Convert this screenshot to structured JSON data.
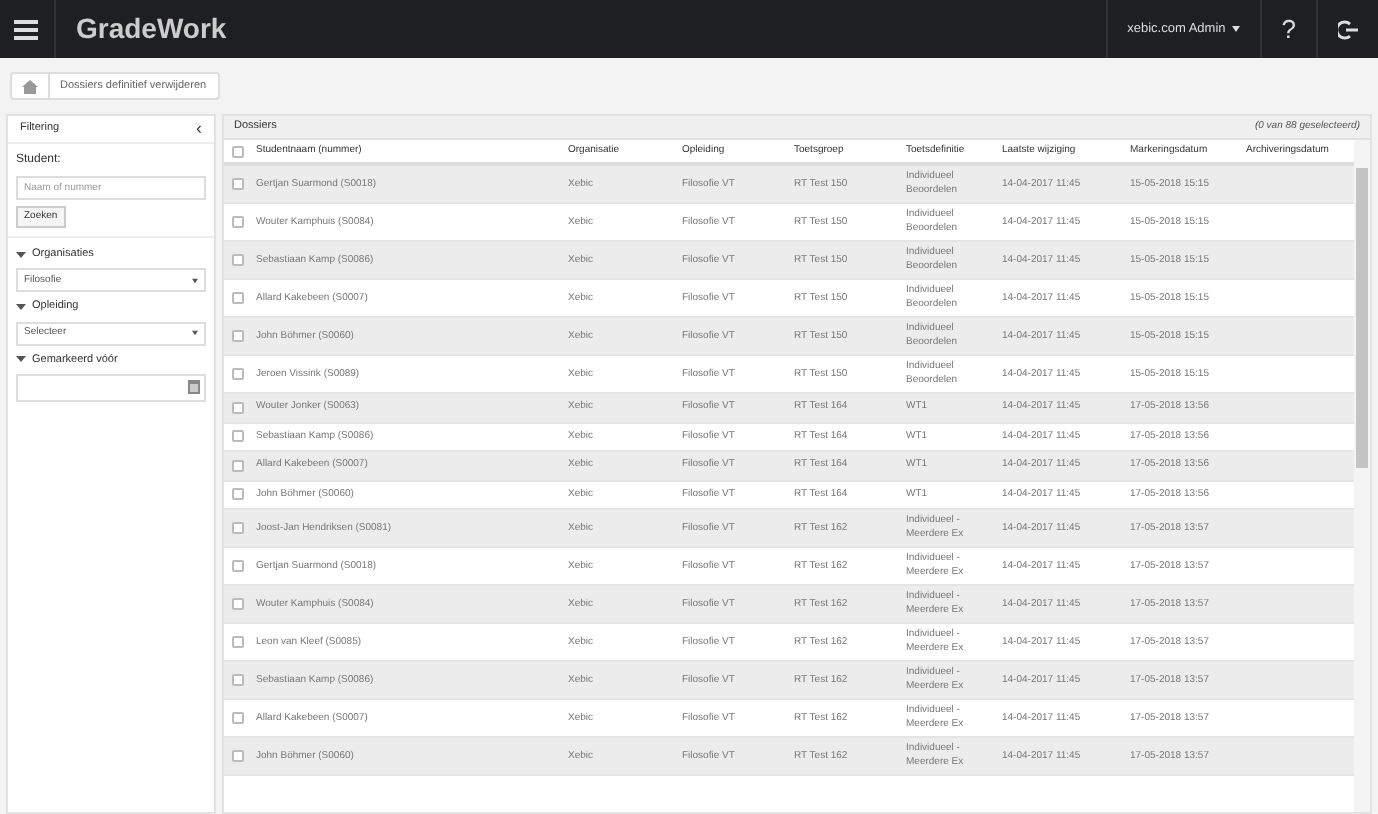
{
  "app": {
    "title": "GradeWork",
    "user_menu": "xebic.com Admin",
    "help": "?"
  },
  "breadcrumb": [
    "Dossiers definitief verwijderen"
  ],
  "filter": {
    "title": "Filtering",
    "collapse": "‹",
    "student_label": "Student:",
    "student_placeholder": "Naam of nummer",
    "search_button": "Zoeken",
    "sections": [
      {
        "label": "Organisaties",
        "expanded": true,
        "kind": "select",
        "value": "Filosofie"
      },
      {
        "label": "Opleiding",
        "expanded": true,
        "kind": "select",
        "value": "Selecteer"
      },
      {
        "label": "Gemarkeerd vóór",
        "expanded": true,
        "kind": "date"
      }
    ]
  },
  "table": {
    "title": "Dossiers",
    "selection_count": "(0 van 88 geselecteerd)",
    "all_checked": false,
    "columns": [
      "Studentnaam (nummer)",
      "Organisatie",
      "Opleiding",
      "Toetsgroep",
      "Toetsdefinitie",
      "Laatste wijziging",
      "Markeringsdatum",
      "Archiveringsdatum"
    ],
    "rows": [
      {
        "checked": false,
        "cells": [
          "Gertjan Suarmond (S0018)",
          "Xebic",
          "Filosofie VT",
          "RT Test 150",
          "Individueel Beoordelen",
          "14-04-2017 11:45",
          "15-05-2018 15:15"
        ]
      },
      {
        "checked": false,
        "cells": [
          "Wouter Kamphuis (S0084)",
          "Xebic",
          "Filosofie VT",
          "RT Test 150",
          "Individueel Beoordelen",
          "14-04-2017 11:45",
          "15-05-2018 15:15"
        ]
      },
      {
        "checked": false,
        "cells": [
          "Sebastiaan Kamp (S0086)",
          "Xebic",
          "Filosofie VT",
          "RT Test 150",
          "Individueel Beoordelen",
          "14-04-2017 11:45",
          "15-05-2018 15:15"
        ]
      },
      {
        "checked": false,
        "cells": [
          "Allard Kakebeen (S0007)",
          "Xebic",
          "Filosofie VT",
          "RT Test 150",
          "Individueel Beoordelen",
          "14-04-2017 11:45",
          "15-05-2018 15:15"
        ]
      },
      {
        "checked": false,
        "cells": [
          "John Böhmer (S0060)",
          "Xebic",
          "Filosofie VT",
          "RT Test 150",
          "Individueel Beoordelen",
          "14-04-2017 11:45",
          "15-05-2018 15:15"
        ]
      },
      {
        "checked": false,
        "cells": [
          "Jeroen Vissink (S0089)",
          "Xebic",
          "Filosofie VT",
          "RT Test 150",
          "Individueel Beoordelen",
          "14-04-2017 11:45",
          "15-05-2018 15:15"
        ]
      },
      {
        "checked": false,
        "cells": [
          "Wouter Jonker (S0063)",
          "Xebic",
          "Filosofie VT",
          "RT Test 164",
          "WT1",
          "14-04-2017 11:45",
          "17-05-2018 13:56"
        ]
      },
      {
        "checked": false,
        "cells": [
          "Sebastiaan Kamp (S0086)",
          "Xebic",
          "Filosofie VT",
          "RT Test 164",
          "WT1",
          "14-04-2017 11:45",
          "17-05-2018 13:56"
        ]
      },
      {
        "checked": false,
        "cells": [
          "Allard Kakebeen (S0007)",
          "Xebic",
          "Filosofie VT",
          "RT Test 164",
          "WT1",
          "14-04-2017 11:45",
          "17-05-2018 13:56"
        ]
      },
      {
        "checked": false,
        "cells": [
          "John Böhmer (S0060)",
          "Xebic",
          "Filosofie VT",
          "RT Test 164",
          "WT1",
          "14-04-2017 11:45",
          "17-05-2018 13:56"
        ]
      },
      {
        "checked": false,
        "cells": [
          "Joost-Jan Hendriksen (S0081)",
          "Xebic",
          "Filosofie VT",
          "RT Test 162",
          "Individueel - Meerdere Ex",
          "14-04-2017 11:45",
          "17-05-2018 13:57"
        ]
      },
      {
        "checked": false,
        "cells": [
          "Gertjan Suarmond (S0018)",
          "Xebic",
          "Filosofie VT",
          "RT Test 162",
          "Individueel - Meerdere Ex",
          "14-04-2017 11:45",
          "17-05-2018 13:57"
        ]
      },
      {
        "checked": false,
        "cells": [
          "Wouter Kamphuis (S0084)",
          "Xebic",
          "Filosofie VT",
          "RT Test 162",
          "Individueel - Meerdere Ex",
          "14-04-2017 11:45",
          "17-05-2018 13:57"
        ]
      },
      {
        "checked": false,
        "cells": [
          "Leon van Kleef (S0085)",
          "Xebic",
          "Filosofie VT",
          "RT Test 162",
          "Individueel - Meerdere Ex",
          "14-04-2017 11:45",
          "17-05-2018 13:57"
        ]
      },
      {
        "checked": false,
        "cells": [
          "Sebastiaan Kamp (S0086)",
          "Xebic",
          "Filosofie VT",
          "RT Test 162",
          "Individueel - Meerdere Ex",
          "14-04-2017 11:45",
          "17-05-2018 13:57"
        ]
      },
      {
        "checked": false,
        "cells": [
          "Allard Kakebeen (S0007)",
          "Xebic",
          "Filosofie VT",
          "RT Test 162",
          "Individueel - Meerdere Ex",
          "14-04-2017 11:45",
          "17-05-2018 13:57"
        ]
      },
      {
        "checked": false,
        "cells": [
          "John Böhmer (S0060)",
          "Xebic",
          "Filosofie VT",
          "RT Test 162",
          "Individueel - Meerdere Ex",
          "14-04-2017 11:45",
          "17-05-2018 13:57"
        ]
      }
    ]
  }
}
